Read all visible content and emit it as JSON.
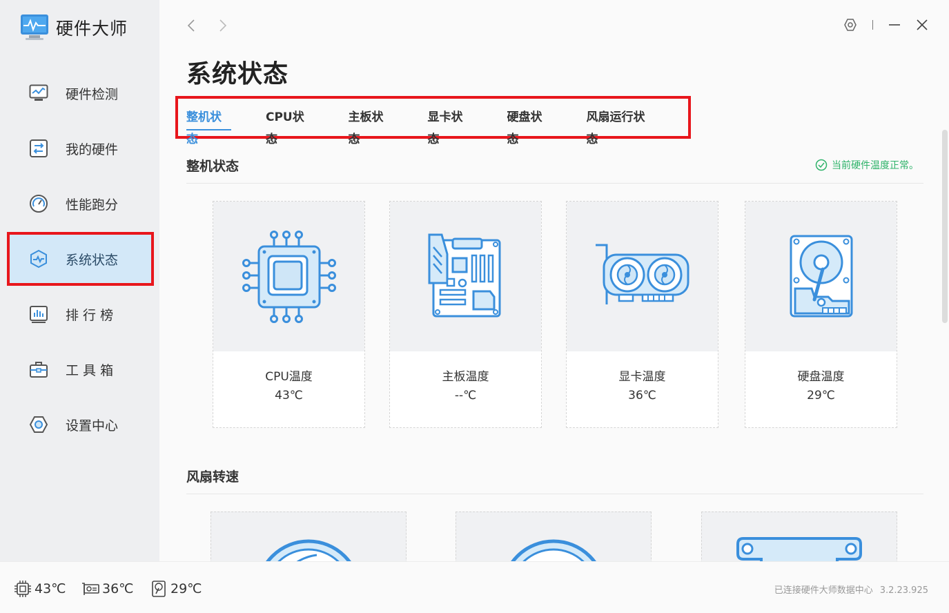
{
  "app": {
    "name": "硬件大师"
  },
  "sidebar": {
    "items": [
      {
        "label": "硬件检测",
        "icon": "monitor-chart-icon"
      },
      {
        "label": "我的硬件",
        "icon": "hardware-icon"
      },
      {
        "label": "性能跑分",
        "icon": "gauge-icon"
      },
      {
        "label": "系统状态",
        "icon": "system-status-icon",
        "active": true
      },
      {
        "label": "排 行 榜",
        "icon": "ranking-icon"
      },
      {
        "label": "工 具 箱",
        "icon": "toolbox-icon"
      },
      {
        "label": "设置中心",
        "icon": "settings-hex-icon"
      }
    ]
  },
  "main": {
    "title": "系统状态",
    "tabs": [
      "整机状态",
      "CPU状态",
      "主板状态",
      "显卡状态",
      "硬盘状态",
      "风扇运行状态"
    ],
    "active_tab": "整机状态",
    "section1": {
      "title": "整机状态",
      "status": "当前硬件温度正常。",
      "cards": [
        {
          "label": "CPU温度",
          "value": "43℃",
          "icon": "cpu-chip-icon"
        },
        {
          "label": "主板温度",
          "value": "--℃",
          "icon": "motherboard-icon"
        },
        {
          "label": "显卡温度",
          "value": "36℃",
          "icon": "graphics-card-icon"
        },
        {
          "label": "硬盘温度",
          "value": "29℃",
          "icon": "hard-disk-icon"
        }
      ]
    },
    "section2": {
      "title": "风扇转速"
    }
  },
  "footer": {
    "cpu_temp": "43℃",
    "gpu_temp": "36℃",
    "disk_temp": "29℃",
    "connection": "已连接硬件大师数据中心",
    "version": "3.2.23.925"
  },
  "colors": {
    "accent": "#3a8fdc",
    "icon_blue": "#3a8fdc",
    "icon_fill": "#cfe6f7",
    "ok_green": "#2fb36a",
    "highlight_red": "#e8161c"
  }
}
